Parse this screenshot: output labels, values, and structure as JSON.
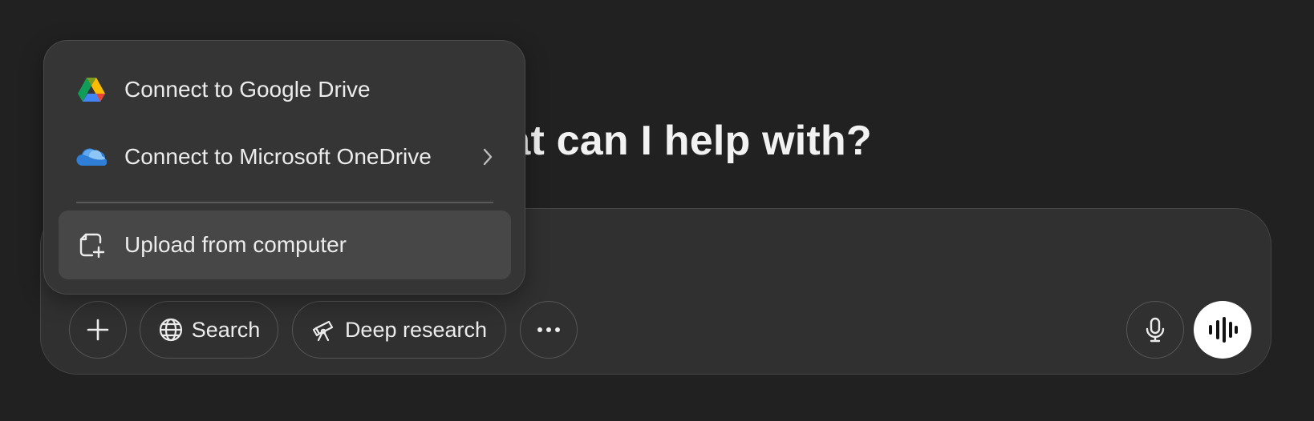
{
  "headline": "What can I help with?",
  "menu": {
    "items": [
      {
        "label": "Connect to Google Drive",
        "icon": "google-drive-icon"
      },
      {
        "label": "Connect to Microsoft OneDrive",
        "icon": "onedrive-icon",
        "has_submenu": true
      },
      {
        "label": "Upload from computer",
        "icon": "upload-file-icon",
        "highlighted": true
      }
    ]
  },
  "toolbar": {
    "add_icon": "plus-icon",
    "search_label": "Search",
    "search_icon": "globe-icon",
    "deep_research_label": "Deep research",
    "deep_research_icon": "telescope-icon",
    "more_icon": "ellipsis-icon",
    "mic_icon": "microphone-icon",
    "voice_icon": "voice-mode-icon"
  },
  "colors": {
    "background": "#212121",
    "composer": "#303030",
    "menu": "#353535",
    "menu_highlight": "#474747",
    "voice_button": "#ffffff"
  }
}
